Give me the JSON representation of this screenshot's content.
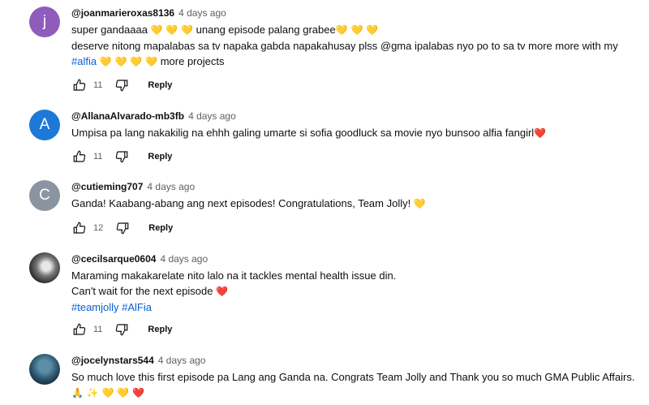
{
  "comments": [
    {
      "avatar_letter": "j",
      "avatar_color": "#8e5dbb",
      "username": "@joanmarieroxas8136",
      "time": "4 days ago",
      "lines": [
        [
          "super gandaaaa ",
          "💛 💛 💛",
          " unang episode palang grabee",
          "💛 💛 💛"
        ],
        [
          "deserve nitong mapalabas sa tv napaka gabda napakahusay plss @gma ipalabas nyo po to sa tv more more with my"
        ],
        [
          "#alfia",
          " 💛 💛 💛 💛",
          " more projects"
        ]
      ],
      "likes": "11",
      "reply_label": "Reply"
    },
    {
      "avatar_letter": "A",
      "avatar_color": "#1e78d7",
      "username": "@AllanaAlvarado-mb3fb",
      "time": "4 days ago",
      "lines": [
        [
          "Umpisa pa lang nakakilig na ehhh galing umarte si sofia goodluck sa movie nyo bunsoo alfia fangirl",
          "❤️"
        ]
      ],
      "likes": "11",
      "reply_label": "Reply"
    },
    {
      "avatar_letter": "C",
      "avatar_color": "#8b95a1",
      "username": "@cutieming707",
      "time": "4 days ago",
      "lines": [
        [
          "Ganda! Kaabang-abang ang next episodes!  Congratulations, Team Jolly! ",
          "💛"
        ]
      ],
      "likes": "12",
      "reply_label": "Reply"
    },
    {
      "avatar_letter": "",
      "avatar_color": "#333333",
      "username": "@cecilsarque0604",
      "time": "4 days ago",
      "lines": [
        [
          "Maraming makakarelate nito lalo na it tackles mental health issue din."
        ],
        [
          "Can't wait for the next episode ",
          "❤️"
        ],
        [
          "#teamjolly #AlFia"
        ]
      ],
      "likes": "11",
      "reply_label": "Reply"
    },
    {
      "avatar_letter": "",
      "avatar_color": "#2c5168",
      "username": "@jocelynstars544",
      "time": "4 days ago",
      "lines": [
        [
          "So much love this first episode pa Lang ang Ganda na. Congrats Team Jolly and Thank you so much GMA Public Affairs."
        ],
        [
          "🙏 ✨ 💛 💛 ❤️"
        ]
      ]
    }
  ],
  "colors": {
    "link": "#065fd4",
    "meta": "#606060"
  }
}
